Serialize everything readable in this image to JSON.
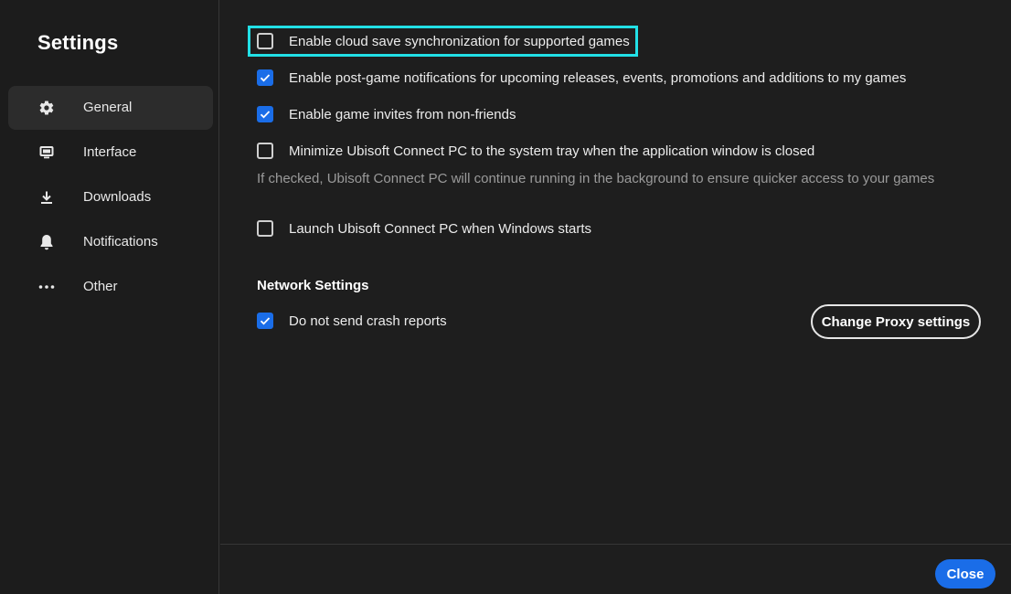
{
  "sidebar": {
    "title": "Settings",
    "items": [
      {
        "label": "General",
        "icon": "gear-icon",
        "active": true
      },
      {
        "label": "Interface",
        "icon": "monitor-icon",
        "active": false
      },
      {
        "label": "Downloads",
        "icon": "download-icon",
        "active": false
      },
      {
        "label": "Notifications",
        "icon": "bell-icon",
        "active": false
      },
      {
        "label": "Other",
        "icon": "more-icon",
        "active": false
      }
    ]
  },
  "general": {
    "options": [
      {
        "label": "Enable cloud save synchronization for supported games",
        "checked": false,
        "focused": true
      },
      {
        "label": "Enable post-game notifications for upcoming releases, events, promotions and additions to my games",
        "checked": true
      },
      {
        "label": "Enable game invites from non-friends",
        "checked": true
      },
      {
        "label": "Minimize Ubisoft Connect PC to the system tray when the application window is closed",
        "checked": false
      },
      {
        "label": "Launch Ubisoft Connect PC when Windows starts",
        "checked": false
      }
    ],
    "tray_hint": "If checked, Ubisoft Connect PC will continue running in the background to ensure quicker access to your games"
  },
  "network": {
    "title": "Network Settings",
    "crash_reports": {
      "label": "Do not send crash reports",
      "checked": true
    },
    "proxy_button": "Change Proxy settings"
  },
  "footer": {
    "close_label": "Close"
  },
  "colors": {
    "accent": "#1a6de8",
    "focus": "#22e0e6",
    "background": "#1e1e1e"
  }
}
